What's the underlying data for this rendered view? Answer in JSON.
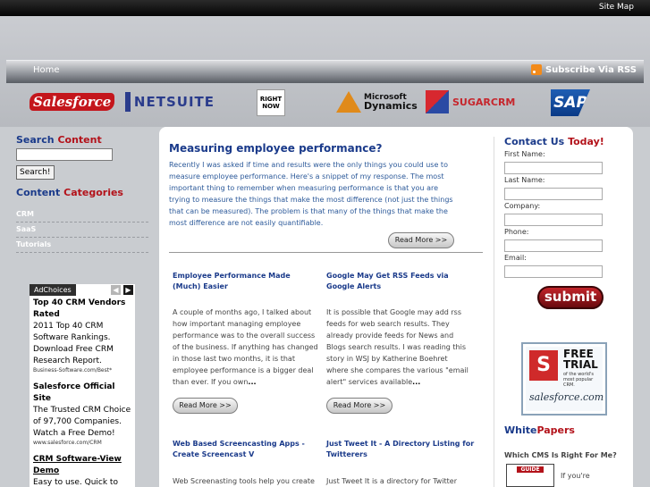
{
  "topbar": {
    "site_map": "Site Map"
  },
  "nav": {
    "home": "Home",
    "rss": "Subscribe Via RSS"
  },
  "logos": {
    "salesforce": "Salesforce",
    "netsuite": "NETSUITE",
    "rightnow_1": "RIGHT",
    "rightnow_2": "NOW",
    "ms_1": "Microsoft",
    "ms_2": "Dynamics",
    "sugarcrm": "SUGARCRM",
    "sap": "SAP"
  },
  "left": {
    "search_heading_1": "Search",
    "search_heading_2": "Content",
    "search_button": "Search!",
    "cat_heading_1": "Content",
    "cat_heading_2": "Categories",
    "categories": [
      "CRM",
      "SaaS",
      "Tutorials"
    ]
  },
  "ads": {
    "adchoices": "AdChoices",
    "items": [
      {
        "title": "Top 40 CRM Vendors Rated",
        "body": "2011 Top 40 CRM Software Rankings. Download Free CRM Research Report.",
        "url": "Business-Software.com/Best*"
      },
      {
        "title": "Salesforce Official Site",
        "body": "The Trusted CRM Choice of 97,700 Companies. Watch a Free Demo!",
        "url": "www.salesforce.com/CRM"
      },
      {
        "title": "CRM Software-View Demo",
        "body": "Easy to use. Quick to",
        "url": ""
      }
    ]
  },
  "featured": {
    "title": "Measuring employee performance?",
    "body": "Recently I was asked if time and results were the only things you could use to measure employee performance. Here's a snippet of my response. The most important thing to remember when measuring performance is that you are trying to measure the things that make the most difference (not just the things that can be measured). The problem is that many of the things that make the most difference are not easily quantifiable.",
    "more": "Read More >>"
  },
  "posts": [
    {
      "title": "Employee Performance Made (Much) Easier",
      "body": "A couple of months ago, I talked about how important managing employee performance was to the overall success of the business. If anything has changed in those last two months, it is that employee performance is a bigger deal than ever. If you own",
      "ellipsis": "...",
      "more": "Read More >>"
    },
    {
      "title": "Google May Get RSS Feeds via Google Alerts",
      "body": "It is possible that Google may add rss feeds for web search results. They already provide feeds for News and Blogs search results. I was reading this story in WSJ by Katherine Boehret where she compares the various \"email alert\" services available",
      "ellipsis": "...",
      "more": "Read More >>"
    },
    {
      "title": "Web Based Screencasting Apps - Create Screencast V",
      "body": "Web Screenasting tools help you create",
      "ellipsis": "",
      "more": ""
    },
    {
      "title": "Just Tweet It - A Directory Listing for Twitterers",
      "body": "Just Tweet It is a directory for Twitter",
      "ellipsis": "",
      "more": ""
    }
  ],
  "contact": {
    "title_1": "Contact Us",
    "title_2": "Today!",
    "fields": [
      "First Name:",
      "Last Name:",
      "Company:",
      "Phone:",
      "Email:"
    ],
    "submit": "submit"
  },
  "trial": {
    "badge": "S",
    "free": "FREE",
    "trial": "TRIAL",
    "sub": "of the world's most popular CRM.",
    "brand": "salesforce.com"
  },
  "whitepapers": {
    "title_1": "White",
    "title_2": "Papers",
    "question": "Which CMS Is Right For Me?",
    "guide": "GUIDE",
    "side": "If you're"
  }
}
